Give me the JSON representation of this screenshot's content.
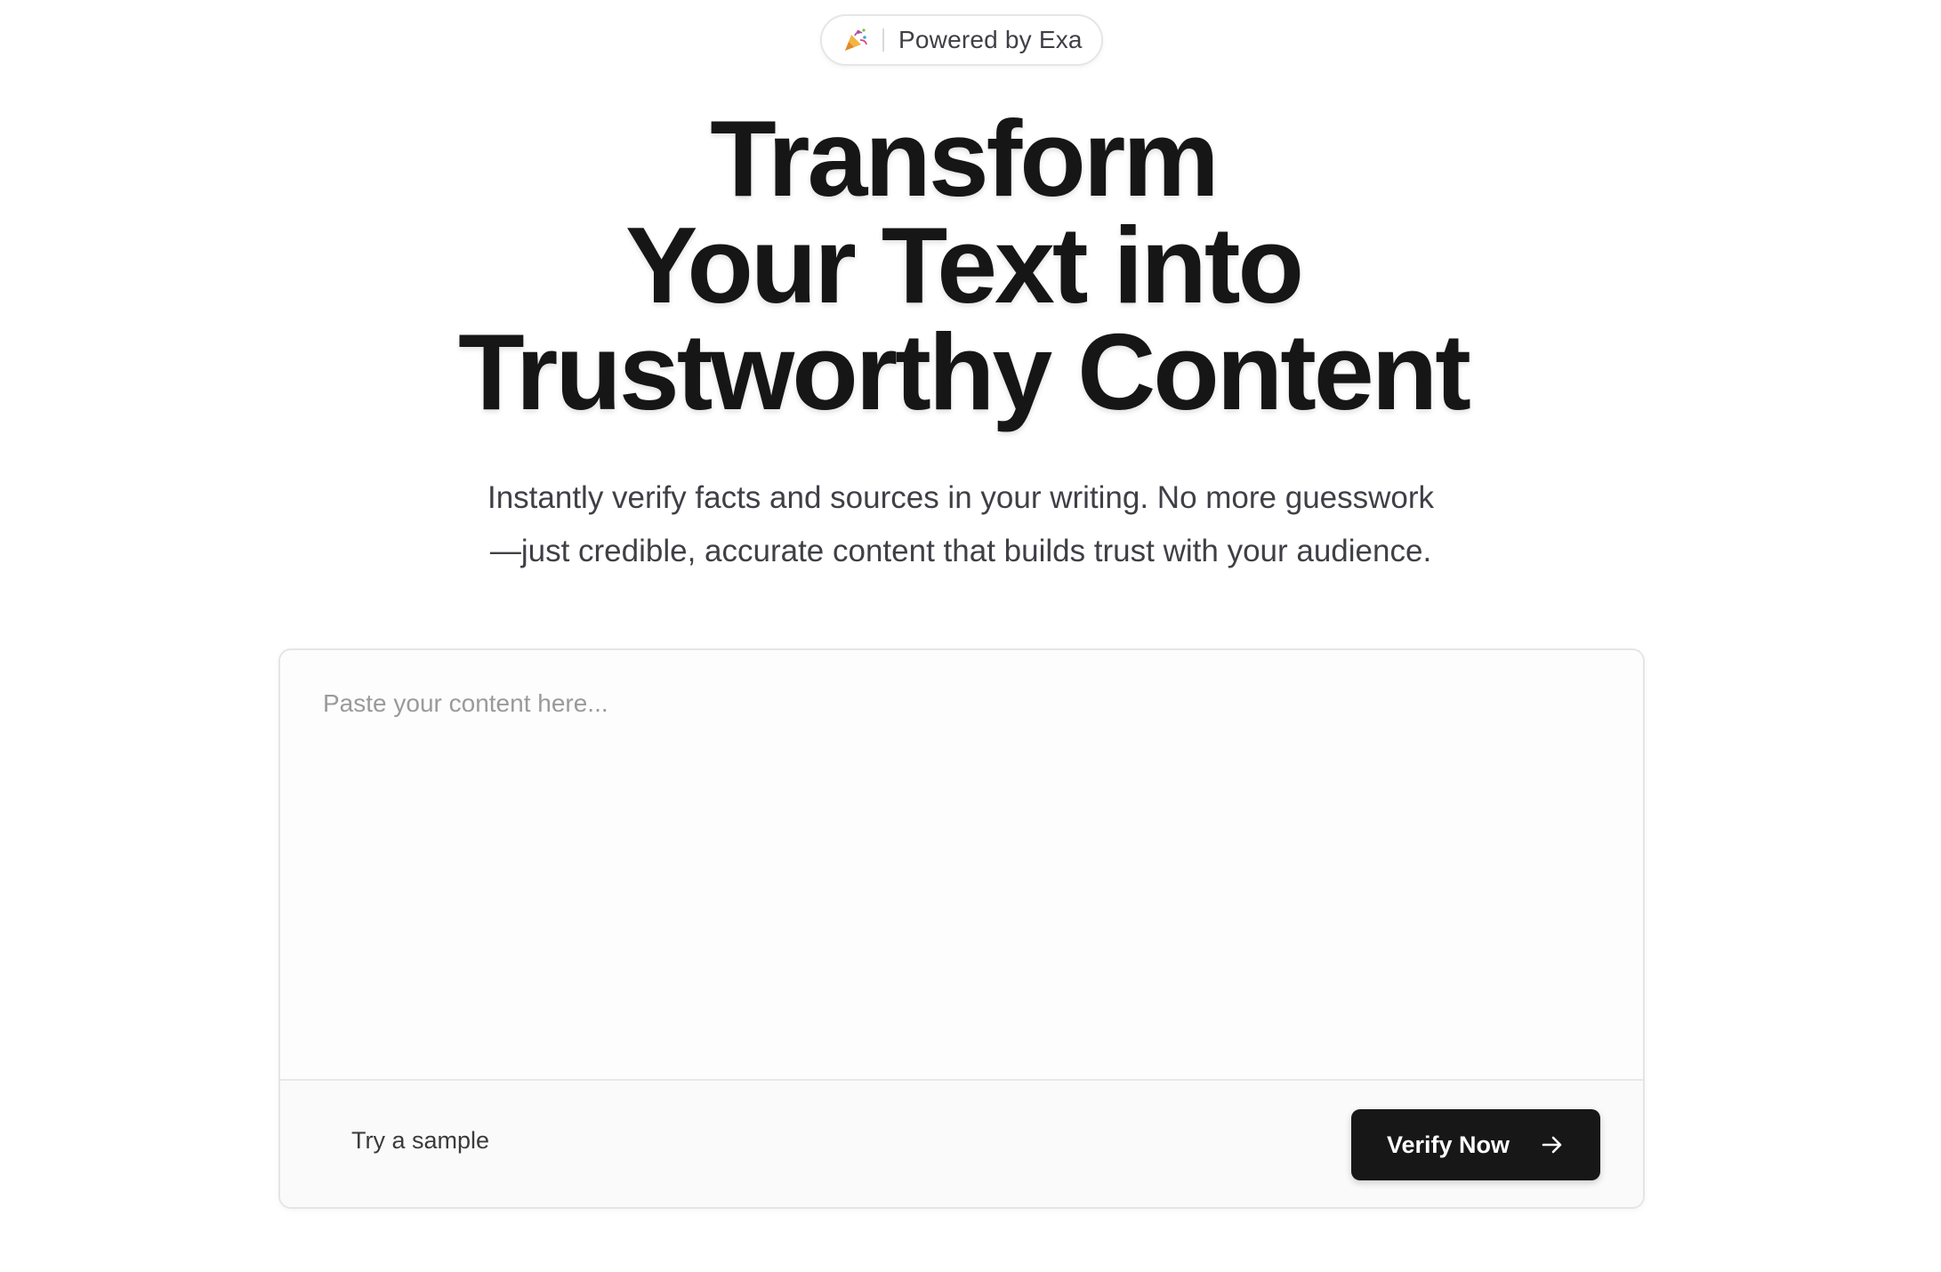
{
  "badge": {
    "icon": "party-popper-icon",
    "text": "Powered by Exa"
  },
  "hero": {
    "headline_lines": [
      "Transform",
      "Your Text into",
      "Trustworthy Content"
    ],
    "subtitle_lines": [
      "Instantly verify facts and sources in your writing. No more guesswork",
      "—just credible, accurate content that builds trust with your audience."
    ]
  },
  "editor": {
    "placeholder": "Paste your content here...",
    "value": ""
  },
  "footer": {
    "sample_label": "Try a sample",
    "verify_label": "Verify Now",
    "verify_icon": "arrow-right-icon"
  },
  "colors": {
    "primary_button": "#171717",
    "text_primary": "#161616",
    "text_secondary": "#3f3f46",
    "placeholder": "#9a9a9a",
    "border": "#e5e5e5"
  }
}
